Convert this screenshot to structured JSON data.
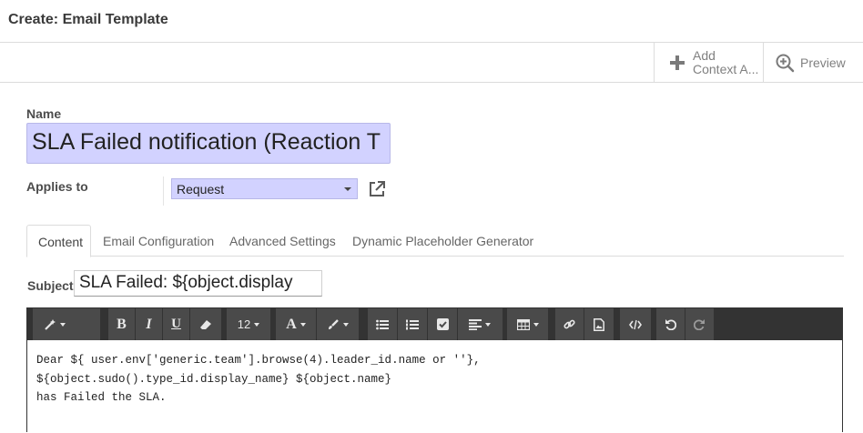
{
  "header": {
    "title": "Create: Email Template"
  },
  "smart_buttons": {
    "add_context_line1": "Add",
    "add_context_line2": "Context A...",
    "preview": "Preview"
  },
  "form": {
    "name_label": "Name",
    "name_value": "SLA Failed notification (Reaction T",
    "applies_to_label": "Applies to",
    "applies_to_value": "Request",
    "subject_label": "Subject",
    "subject_value": "SLA Failed: ${object.display"
  },
  "tabs": [
    {
      "label": "Content",
      "active": true
    },
    {
      "label": "Email Configuration",
      "active": false
    },
    {
      "label": "Advanced Settings",
      "active": false
    },
    {
      "label": "Dynamic Placeholder Generator",
      "active": false
    }
  ],
  "toolbar": {
    "font_size": "12",
    "bold": "B",
    "italic": "I",
    "underline": "U",
    "font_color": "A",
    "icons": [
      "magic-wand-icon",
      "bold-icon",
      "italic-icon",
      "underline-icon",
      "eraser-icon",
      "font-size-dropdown",
      "font-color-icon",
      "paint-brush-icon",
      "unordered-list-icon",
      "ordered-list-icon",
      "checklist-icon",
      "align-icon",
      "table-icon",
      "link-icon",
      "image-icon",
      "code-view-icon",
      "undo-icon",
      "redo-icon"
    ]
  },
  "editor": {
    "lines": [
      "Dear ${ user.env['generic.team'].browse(4).leader_id.name or ''},",
      "${object.sudo().type_id.display_name} ${object.name}",
      "has Failed the SLA."
    ]
  },
  "colors": {
    "input_highlight": "#d2d2ff",
    "toolbar_bg": "#333333",
    "toolbar_group_bg": "#4a4a4a",
    "muted_text": "#808080"
  }
}
